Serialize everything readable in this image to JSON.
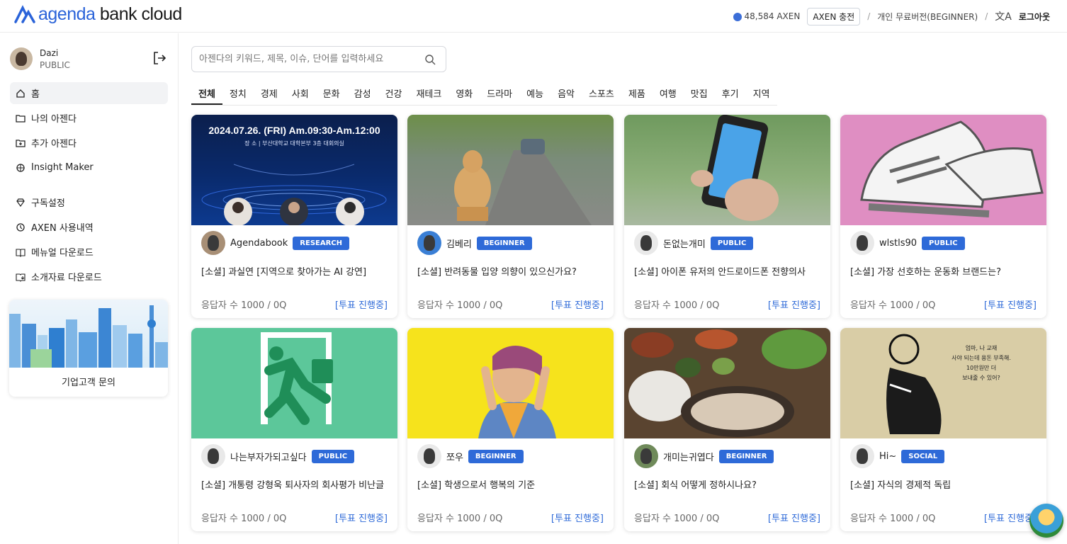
{
  "header": {
    "logo": {
      "prefix": "agenda",
      "suffix": "bank cloud"
    },
    "axen_balance": "48,584 AXEN",
    "charge_label": "AXEN 충전",
    "plan_label": "개인 무료버전(BEGINNER)",
    "translate_icon": "translate-icon",
    "logout_label": "로그아웃"
  },
  "sidebar": {
    "user": {
      "name": "Dazi",
      "plan": "PUBLIC"
    },
    "items": [
      {
        "label": "홈",
        "icon": "home-icon",
        "active": true
      },
      {
        "label": "나의 아젠다",
        "icon": "folder-icon"
      },
      {
        "label": "추가 아젠다",
        "icon": "folder-plus-icon"
      },
      {
        "label": "Insight Maker",
        "icon": "insight-icon"
      },
      {
        "label": "구독설정",
        "icon": "diamond-icon"
      },
      {
        "label": "AXEN 사용내역",
        "icon": "history-icon"
      },
      {
        "label": "메뉴얼 다운로드",
        "icon": "book-icon"
      },
      {
        "label": "소개자료 다운로드",
        "icon": "book-download-icon"
      }
    ],
    "promo_label": "기업고객 문의"
  },
  "search": {
    "placeholder": "아젠다의 키워드, 제목, 이슈, 단어를 입력하세요"
  },
  "categories": [
    "전체",
    "정치",
    "경제",
    "사회",
    "문화",
    "감성",
    "건강",
    "재테크",
    "영화",
    "드라마",
    "예능",
    "음악",
    "스포츠",
    "제품",
    "여행",
    "맛집",
    "후기",
    "지역"
  ],
  "cards": [
    {
      "author": "Agendabook",
      "badge": "RESEARCH",
      "title": "[소셜] 과실연 [지역으로 찾아가는 AI 강연]",
      "responses": "응답자 수  1000 / 0Q",
      "status": "[투표 진행중]",
      "banner": {
        "date": "2024.07.26. (FRI) Am.09:30-Am.12:00",
        "place": "장 소  |  부산대학교 대학본부 3층 대회의실"
      }
    },
    {
      "author": "김베리",
      "badge": "BEGINNER",
      "title": "[소셜] 반려동물 입양 의향이 있으신가요?",
      "responses": "응답자 수  1000 / 0Q",
      "status": "[투표 진행중]"
    },
    {
      "author": "돈없는개미",
      "badge": "PUBLIC",
      "title": "[소셜] 아이폰 유저의 안드로이드폰 전향의사",
      "responses": "응답자 수  1000 / 0Q",
      "status": "[투표 진행중]"
    },
    {
      "author": "wlstls90",
      "badge": "PUBLIC",
      "title": "[소셜] 가장 선호하는 운동화 브랜드는?",
      "responses": "응답자 수  1000 / 0Q",
      "status": "[투표 진행중]"
    },
    {
      "author": "나는부자가되고싶다",
      "badge": "PUBLIC",
      "title": "[소셜] 개통령 강형욱 퇴사자의 회사평가 비난글",
      "responses": "응답자 수  1000 / 0Q",
      "status": "[투표 진행중]"
    },
    {
      "author": "쪼우",
      "badge": "BEGINNER",
      "title": "[소셜] 학생으로서 행복의 기준",
      "responses": "응답자 수  1000 / 0Q",
      "status": "[투표 진행중]"
    },
    {
      "author": "개미는귀엽다",
      "badge": "BEGINNER",
      "title": "[소셜] 회식 어떻게 정하시나요?",
      "responses": "응답자 수  1000 / 0Q",
      "status": "[투표 진행중]"
    },
    {
      "author": "Hi~",
      "badge": "SOCIAL",
      "title": "[소셜] 자식의 경제적 독립",
      "responses": "응답자 수  1000 / 0Q",
      "status": "[투표 진행중]",
      "bubble": [
        "엄마, 나 교재",
        "사야 되는데 용돈 부족해.",
        "10만원만 더",
        "보내줄 수 있어?"
      ]
    }
  ]
}
